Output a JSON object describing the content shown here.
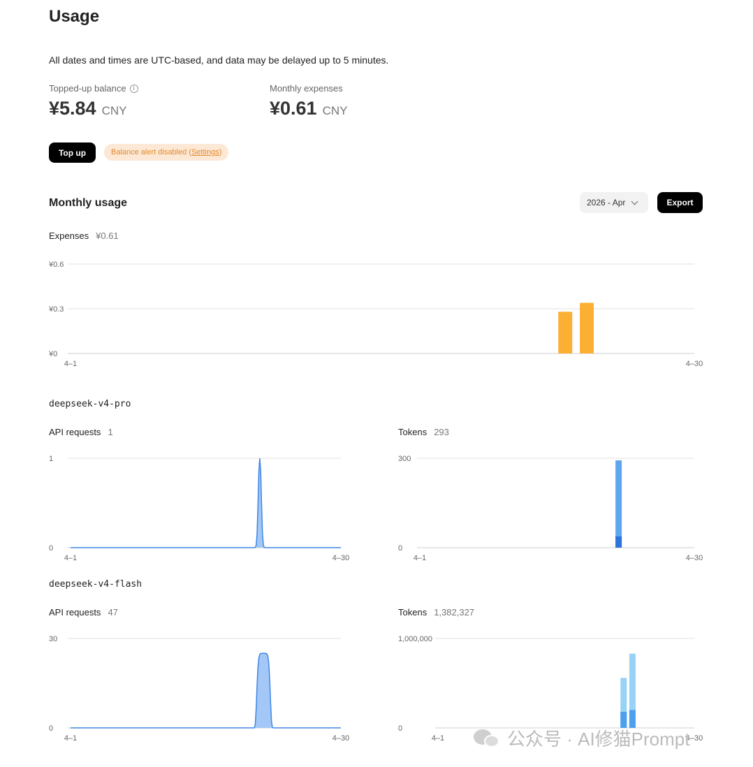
{
  "page": {
    "title": "Usage",
    "notice": "All dates and times are UTC-based, and data may be delayed up to 5 minutes."
  },
  "balance": {
    "label": "Topped-up balance",
    "amount": "¥5.84",
    "currency": "CNY"
  },
  "expenses": {
    "label": "Monthly expenses",
    "amount": "¥0.61",
    "currency": "CNY"
  },
  "actions": {
    "top_up_label": "Top up",
    "alert_text": "Balance alert disabled (",
    "alert_link": "Settings",
    "alert_close": ")"
  },
  "monthly": {
    "title": "Monthly usage",
    "month_selected": "2026 - Apr",
    "export_label": "Export"
  },
  "colors": {
    "expense_bar": "#fbb033",
    "line_stroke": "#3f87e3",
    "line_fill": "#a3c8f7",
    "token_light": "#5ea7f0",
    "token_dark": "#2f73dd",
    "flash_light": "#98d3f5",
    "flash_dark": "#4ba0ef"
  },
  "expenses_chart": {
    "label": "Expenses",
    "total": "¥0.61",
    "chart_data": {
      "type": "bar",
      "x_start": "4–1",
      "x_end": "4–30",
      "days": 30,
      "yticks": [
        "¥0",
        "¥0.3",
        "¥0.6"
      ],
      "ylim": [
        0,
        0.6
      ],
      "points": [
        {
          "day": 24,
          "value": 0.28
        },
        {
          "day": 25,
          "value": 0.34
        }
      ]
    }
  },
  "models": [
    {
      "name": "deepseek-v4-pro",
      "requests": {
        "label": "API requests",
        "total": "1",
        "chart_data": {
          "type": "area",
          "x_start": "4–1",
          "x_end": "4–30",
          "days": 30,
          "yticks": [
            "0",
            "1"
          ],
          "ylim": [
            0,
            1
          ],
          "peak_day": 21.3,
          "peak": 1,
          "plateau": 0.05
        }
      },
      "tokens": {
        "label": "Tokens",
        "total": "293",
        "chart_data": {
          "type": "bar",
          "x_start": "4–1",
          "x_end": "4–30",
          "days": 30,
          "yticks": [
            "0",
            "300"
          ],
          "ylim": [
            0,
            300
          ],
          "points": [
            {
              "day": 22,
              "total": 293,
              "dark": 38
            }
          ]
        }
      }
    },
    {
      "name": "deepseek-v4-flash",
      "requests": {
        "label": "API requests",
        "total": "47",
        "chart_data": {
          "type": "area",
          "x_start": "4–1",
          "x_end": "4–30",
          "days": 30,
          "yticks": [
            "0",
            "30"
          ],
          "ylim": [
            0,
            30
          ],
          "peak_day": 21.7,
          "peak": 25,
          "plateau": 0.8
        }
      },
      "tokens": {
        "label": "Tokens",
        "total": "1,382,327",
        "chart_data": {
          "type": "bar",
          "x_start": "4–1",
          "x_end": "4–30",
          "days": 30,
          "yticks": [
            "0",
            "1,000,000"
          ],
          "ylim": [
            0,
            1000000
          ],
          "points": [
            {
              "day": 22,
              "total": 560000,
              "dark": 180000
            },
            {
              "day": 23,
              "total": 830000,
              "dark": 200000
            }
          ]
        }
      }
    }
  ],
  "watermark": {
    "text": "公众号 · AI修猫Prompt"
  }
}
